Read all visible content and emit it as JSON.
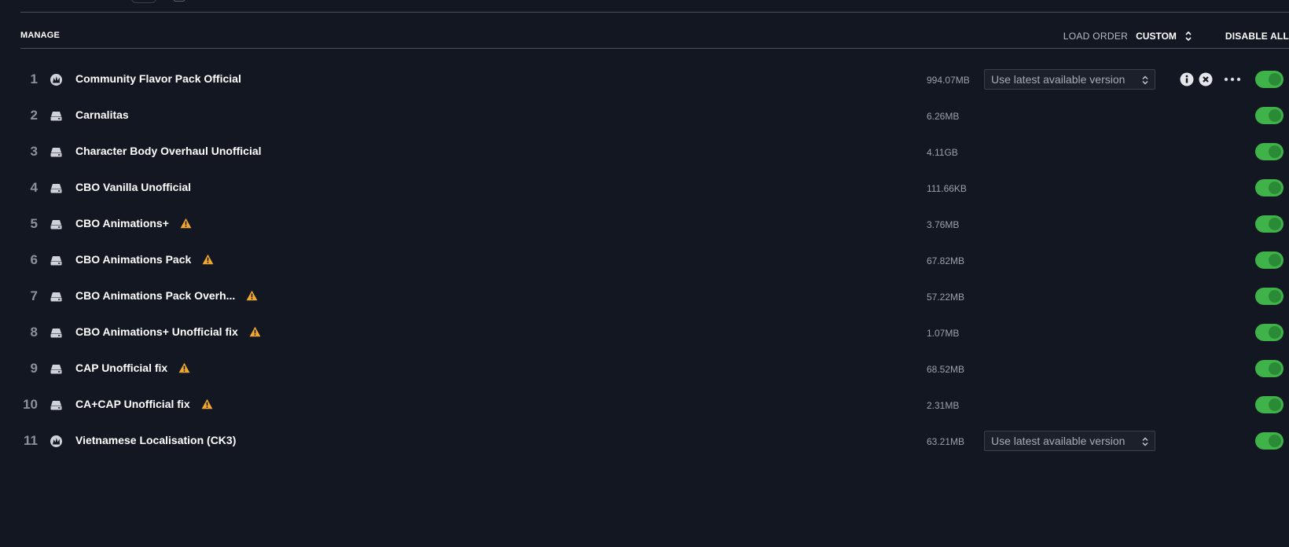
{
  "header": {
    "manage_label": "MANAGE",
    "load_order_label": "LOAD ORDER",
    "load_order_value": "CUSTOM",
    "disable_all_label": "DISABLE ALL"
  },
  "colors": {
    "background": "#131722",
    "toggle_on": "#3fb24a",
    "warning": "#f0a830",
    "text_primary": "#ffffff",
    "text_muted": "#9ca0aa"
  },
  "mods": [
    {
      "index": "1",
      "icon": "paradox-logo-icon",
      "name": "Community Flavor Pack Official",
      "warning": false,
      "size": "994.07MB",
      "version": "Use latest available version",
      "actions": true,
      "enabled": true
    },
    {
      "index": "2",
      "icon": "drive-icon",
      "name": "Carnalitas",
      "warning": false,
      "size": "6.26MB",
      "enabled": true
    },
    {
      "index": "3",
      "icon": "drive-icon",
      "name": "Character Body Overhaul Unofficial",
      "warning": false,
      "size": "4.11GB",
      "enabled": true
    },
    {
      "index": "4",
      "icon": "drive-icon",
      "name": "CBO Vanilla Unofficial",
      "warning": false,
      "size": "111.66KB",
      "enabled": true
    },
    {
      "index": "5",
      "icon": "drive-icon",
      "name": "CBO Animations+",
      "warning": true,
      "size": "3.76MB",
      "enabled": true
    },
    {
      "index": "6",
      "icon": "drive-icon",
      "name": "CBO Animations Pack",
      "warning": true,
      "size": "67.82MB",
      "enabled": true
    },
    {
      "index": "7",
      "icon": "drive-icon",
      "name": "CBO Animations Pack Overh...",
      "warning": true,
      "size": "57.22MB",
      "enabled": true
    },
    {
      "index": "8",
      "icon": "drive-icon",
      "name": "CBO Animations+ Unofficial fix",
      "warning": true,
      "size": "1.07MB",
      "enabled": true
    },
    {
      "index": "9",
      "icon": "drive-icon",
      "name": "CAP Unofficial fix",
      "warning": true,
      "size": "68.52MB",
      "enabled": true
    },
    {
      "index": "10",
      "icon": "drive-icon",
      "name": "CA+CAP Unofficial fix",
      "warning": true,
      "size": "2.31MB",
      "enabled": true
    },
    {
      "index": "11",
      "icon": "paradox-logo-icon",
      "name": "Vietnamese Localisation (CK3)",
      "warning": false,
      "size": "63.21MB",
      "version": "Use latest available version",
      "enabled": true
    }
  ]
}
